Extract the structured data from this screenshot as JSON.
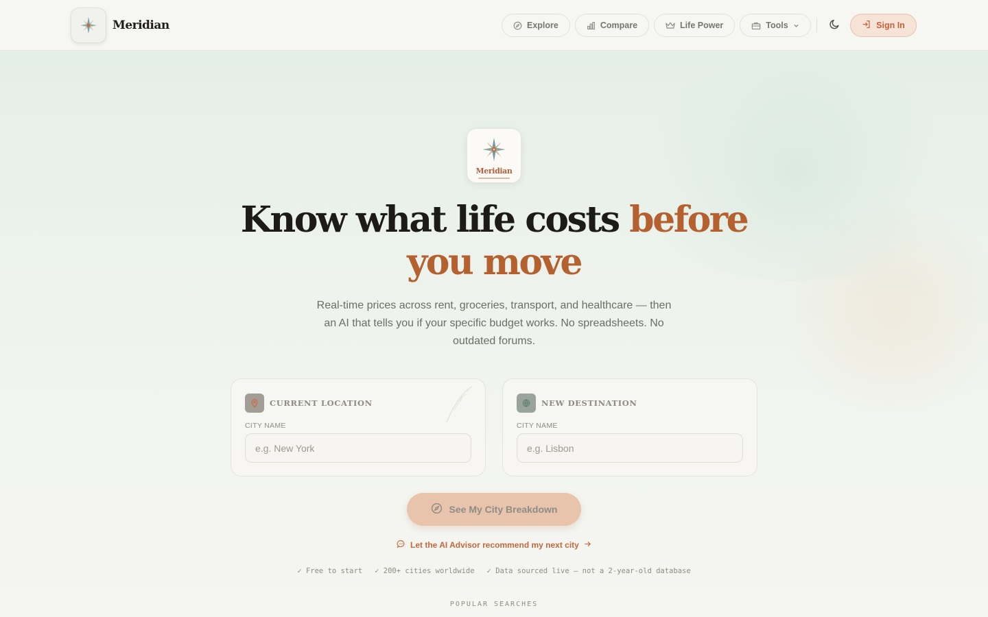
{
  "brand": {
    "name": "Meridian",
    "logo_icon": "compass-rose-icon"
  },
  "nav": {
    "links": [
      {
        "label": "Explore",
        "icon": "compass-icon"
      },
      {
        "label": "Compare",
        "icon": "bar-chart-icon"
      },
      {
        "label": "Life Power",
        "icon": "crown-icon"
      },
      {
        "label": "Tools",
        "icon": "toolbox-icon",
        "has_dropdown": true
      }
    ],
    "theme_toggle_icon": "moon-icon",
    "signin_label": "Sign In"
  },
  "hero": {
    "logo_word": "Meridian",
    "headline_main": "Know what life costs ",
    "headline_accent": "before you move",
    "subtitle": "Real-time prices across rent, groceries, transport, and healthcare — then an AI that tells you if your specific budget works. No spreadsheets. No outdated forums."
  },
  "cards": {
    "current": {
      "title": "CURRENT LOCATION",
      "field_label": "CITY NAME",
      "placeholder": "e.g. New York",
      "icon": "map-pin-icon"
    },
    "destination": {
      "title": "NEW DESTINATION",
      "field_label": "CITY NAME",
      "placeholder": "e.g. Lisbon",
      "icon": "globe-icon"
    }
  },
  "cta": {
    "label": "See My City Breakdown",
    "icon": "compass-icon"
  },
  "ai_link": {
    "label": "Let the AI Advisor recommend my next city",
    "icon": "chat-bubble-icon"
  },
  "checks": [
    "✓ Free to start",
    "✓ 200+ cities worldwide",
    "✓ Data sourced live — not a 2-year-old database"
  ],
  "popular_label": "POPULAR SEARCHES",
  "colors": {
    "accent": "#b5602f",
    "signin_bg": "#f5e3d8",
    "cta_bg": "#e8c4ac",
    "page_top": "#e2eee6",
    "page_bottom": "#f5f5f1"
  }
}
